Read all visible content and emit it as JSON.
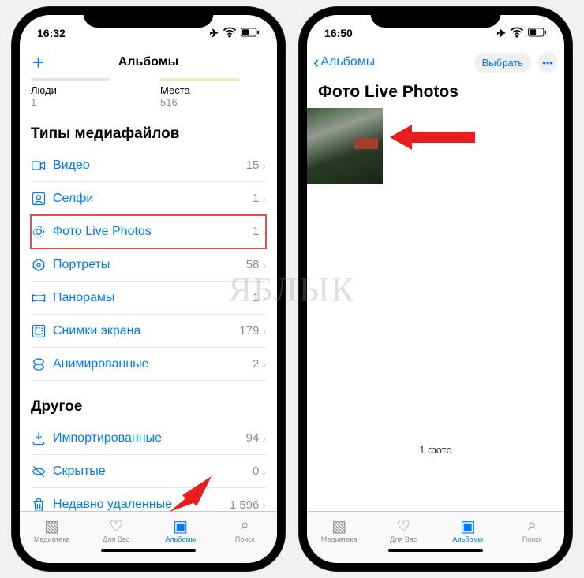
{
  "watermark": "ЯБЛЫК",
  "left": {
    "time": "16:32",
    "title": "Альбомы",
    "thumbs": [
      {
        "title": "Люди",
        "count": "1"
      },
      {
        "title": "Места",
        "count": "516"
      }
    ],
    "section_media": "Типы медиафайлов",
    "media_rows": [
      {
        "icon": "video",
        "label": "Видео",
        "count": "15"
      },
      {
        "icon": "selfie",
        "label": "Селфи",
        "count": "1"
      },
      {
        "icon": "live",
        "label": "Фото Live Photos",
        "count": "1",
        "highlight": true
      },
      {
        "icon": "portrait",
        "label": "Портреты",
        "count": "58"
      },
      {
        "icon": "pano",
        "label": "Панорамы",
        "count": "1"
      },
      {
        "icon": "screenshot",
        "label": "Снимки экрана",
        "count": "179"
      },
      {
        "icon": "animated",
        "label": "Анимированные",
        "count": "2"
      }
    ],
    "section_other": "Другое",
    "other_rows": [
      {
        "icon": "import",
        "label": "Импортированные",
        "count": "94"
      },
      {
        "icon": "hidden",
        "label": "Скрытые",
        "count": "0"
      },
      {
        "icon": "trash",
        "label": "Недавно удаленные",
        "count": "1 596"
      }
    ]
  },
  "right": {
    "time": "16:50",
    "back": "Альбомы",
    "select": "Выбрать",
    "title": "Фото Live Photos",
    "count_label": "1 фото"
  },
  "tabs": [
    {
      "label": "Медиатека"
    },
    {
      "label": "Для Вас"
    },
    {
      "label": "Альбомы",
      "active": true
    },
    {
      "label": "Поиск"
    }
  ]
}
